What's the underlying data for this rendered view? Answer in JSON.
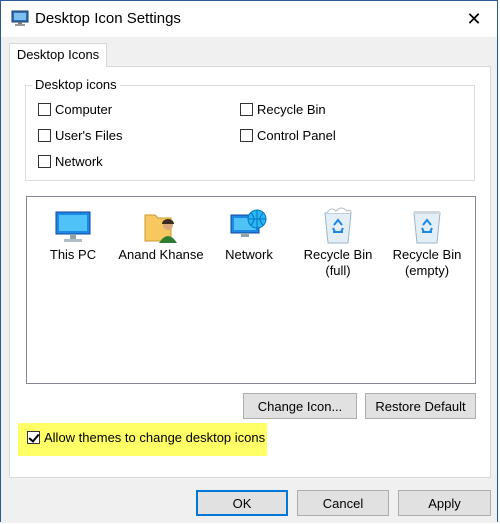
{
  "window": {
    "title": "Desktop Icon Settings"
  },
  "tab": {
    "label": "Desktop Icons"
  },
  "group": {
    "label": "Desktop icons",
    "checkboxes": [
      {
        "label": "Computer",
        "checked": false
      },
      {
        "label": "Recycle Bin",
        "checked": false
      },
      {
        "label": "User's Files",
        "checked": false
      },
      {
        "label": "Control Panel",
        "checked": false
      },
      {
        "label": "Network",
        "checked": false
      }
    ]
  },
  "icons": [
    {
      "label": "This PC",
      "icon": "monitor-icon"
    },
    {
      "label": "Anand Khanse",
      "icon": "user-folder-icon"
    },
    {
      "label": "Network",
      "icon": "network-icon"
    },
    {
      "label": "Recycle Bin\n(full)",
      "icon": "recycle-bin-full-icon"
    },
    {
      "label": "Recycle Bin\n(empty)",
      "icon": "recycle-bin-empty-icon"
    }
  ],
  "buttons": {
    "change_icon": "Change Icon...",
    "restore_default": "Restore Default",
    "ok": "OK",
    "cancel": "Cancel",
    "apply": "Apply"
  },
  "allow_themes": {
    "label": "Allow themes to change desktop icons",
    "checked": true
  },
  "colors": {
    "highlight": "#ffff66",
    "accent": "#0078d7"
  }
}
